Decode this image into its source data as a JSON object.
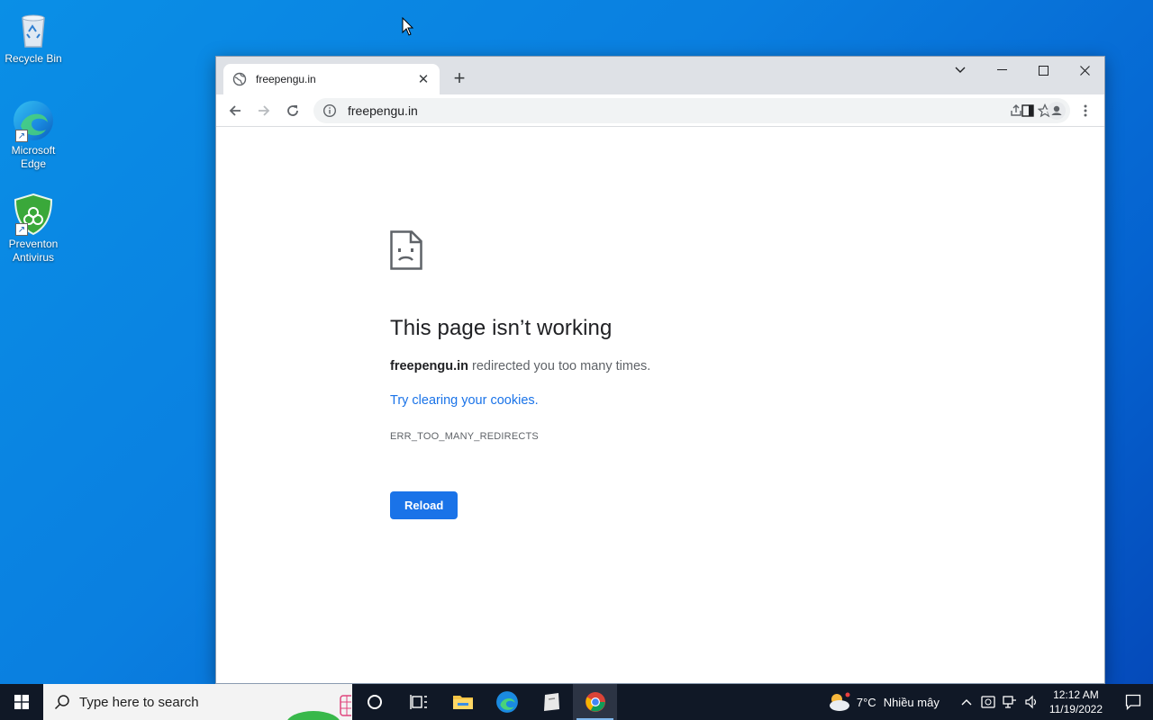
{
  "desktop": {
    "icons": [
      {
        "label": "Recycle Bin"
      },
      {
        "label": "Microsoft Edge"
      },
      {
        "label": "Preventon Antivirus"
      }
    ]
  },
  "browser": {
    "tab": {
      "title": "freepengu.in",
      "close_label": "✕",
      "new_tab_label": "+"
    },
    "window_controls": {
      "dropdown": "⌄",
      "minimize": "—",
      "maximize": "☐",
      "close": "✕"
    },
    "address": {
      "url": "freepengu.in"
    },
    "error": {
      "title": "This page isn’t working",
      "domain": "freepengu.in",
      "message": " redirected you too many times.",
      "link": "Try clearing your cookies.",
      "code": "ERR_TOO_MANY_REDIRECTS",
      "button": "Reload"
    }
  },
  "taskbar": {
    "search_placeholder": "Type here to search",
    "weather": {
      "temp": "7°C",
      "condition": "Nhiều mây"
    },
    "time": "12:12 AM",
    "date": "11/19/2022"
  },
  "colors": {
    "accent": "#1a73e8",
    "taskbar": "#101826"
  }
}
